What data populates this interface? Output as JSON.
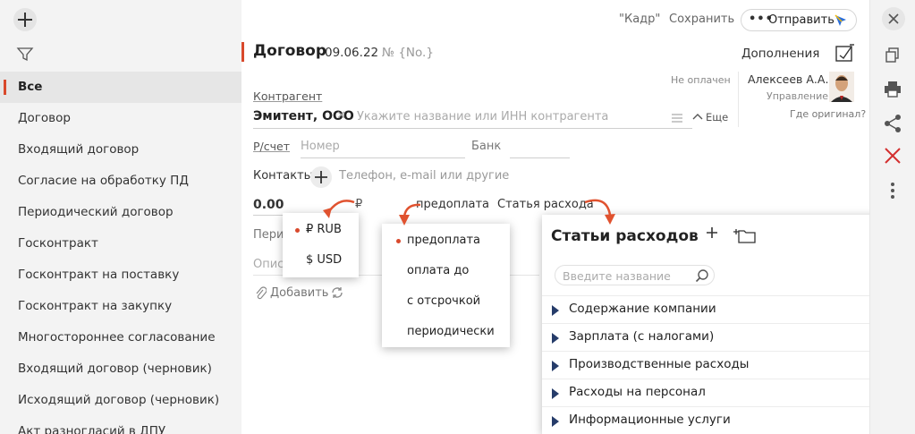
{
  "sidebar": {
    "items": [
      {
        "label": "Все",
        "active": true
      },
      {
        "label": "Договор"
      },
      {
        "label": "Входящий договор"
      },
      {
        "label": "Согласие на обработку ПД"
      },
      {
        "label": "Периодический договор"
      },
      {
        "label": "Госконтракт"
      },
      {
        "label": "Госконтракт на поставку"
      },
      {
        "label": "Госконтракт на закупку"
      },
      {
        "label": "Многостороннее согласование"
      },
      {
        "label": "Входящий договор (черновик)"
      },
      {
        "label": "Исходящий договор (черновик)"
      },
      {
        "label": "Акт разногласий в ДПУ"
      }
    ]
  },
  "topbar": {
    "kadr_label": "\"Кадр\"",
    "save_label": "Сохранить",
    "send_label": "Отправить"
  },
  "document": {
    "title": "Договор",
    "date": "09.06.22",
    "number_placeholder": "№ {No.}",
    "extras_label": "Дополнения",
    "status": "Не оплачен",
    "responsible_name": "Алексеев А.А.",
    "responsible_role": "Управление",
    "original_link": "Где оригинал?"
  },
  "form": {
    "contragent_label": "Контрагент",
    "contragent_name": "Эмитент, ООО",
    "contragent_placeholder": "Укажите название или ИНН контрагента",
    "more_label": "Еще",
    "account_label": "Р/счет",
    "account_placeholder": "Номер",
    "bank_label": "Банк",
    "contacts_label": "Контакты",
    "contacts_placeholder": "Телефон, e-mail или другие",
    "amount": "0.00",
    "currency": "₽",
    "payment_type": "предоплата",
    "expense_label": "Статья расхода",
    "period_label": "Пери",
    "description_label": "Опис",
    "attach_label": "Добавить"
  },
  "currency_popup": {
    "options": [
      {
        "label": "₽ RUB",
        "selected": true
      },
      {
        "label": "$ USD",
        "selected": false
      }
    ]
  },
  "payment_popup": {
    "options": [
      {
        "label": "предоплата",
        "selected": true
      },
      {
        "label": "оплата до",
        "selected": false
      },
      {
        "label": "с отсрочкой",
        "selected": false
      },
      {
        "label": "периодически",
        "selected": false
      }
    ]
  },
  "expense_popup": {
    "title": "Статьи расходов",
    "search_placeholder": "Введите название",
    "items": [
      {
        "label": "Содержание компании"
      },
      {
        "label": "Зарплата (с налогами)"
      },
      {
        "label": "Производственные расходы"
      },
      {
        "label": "Расходы на персонал"
      },
      {
        "label": "Информационные услуги"
      }
    ]
  },
  "colors": {
    "accent": "#d9492c",
    "tree_marker": "#263c6a",
    "sidebar_bg": "#f3f3f3"
  }
}
